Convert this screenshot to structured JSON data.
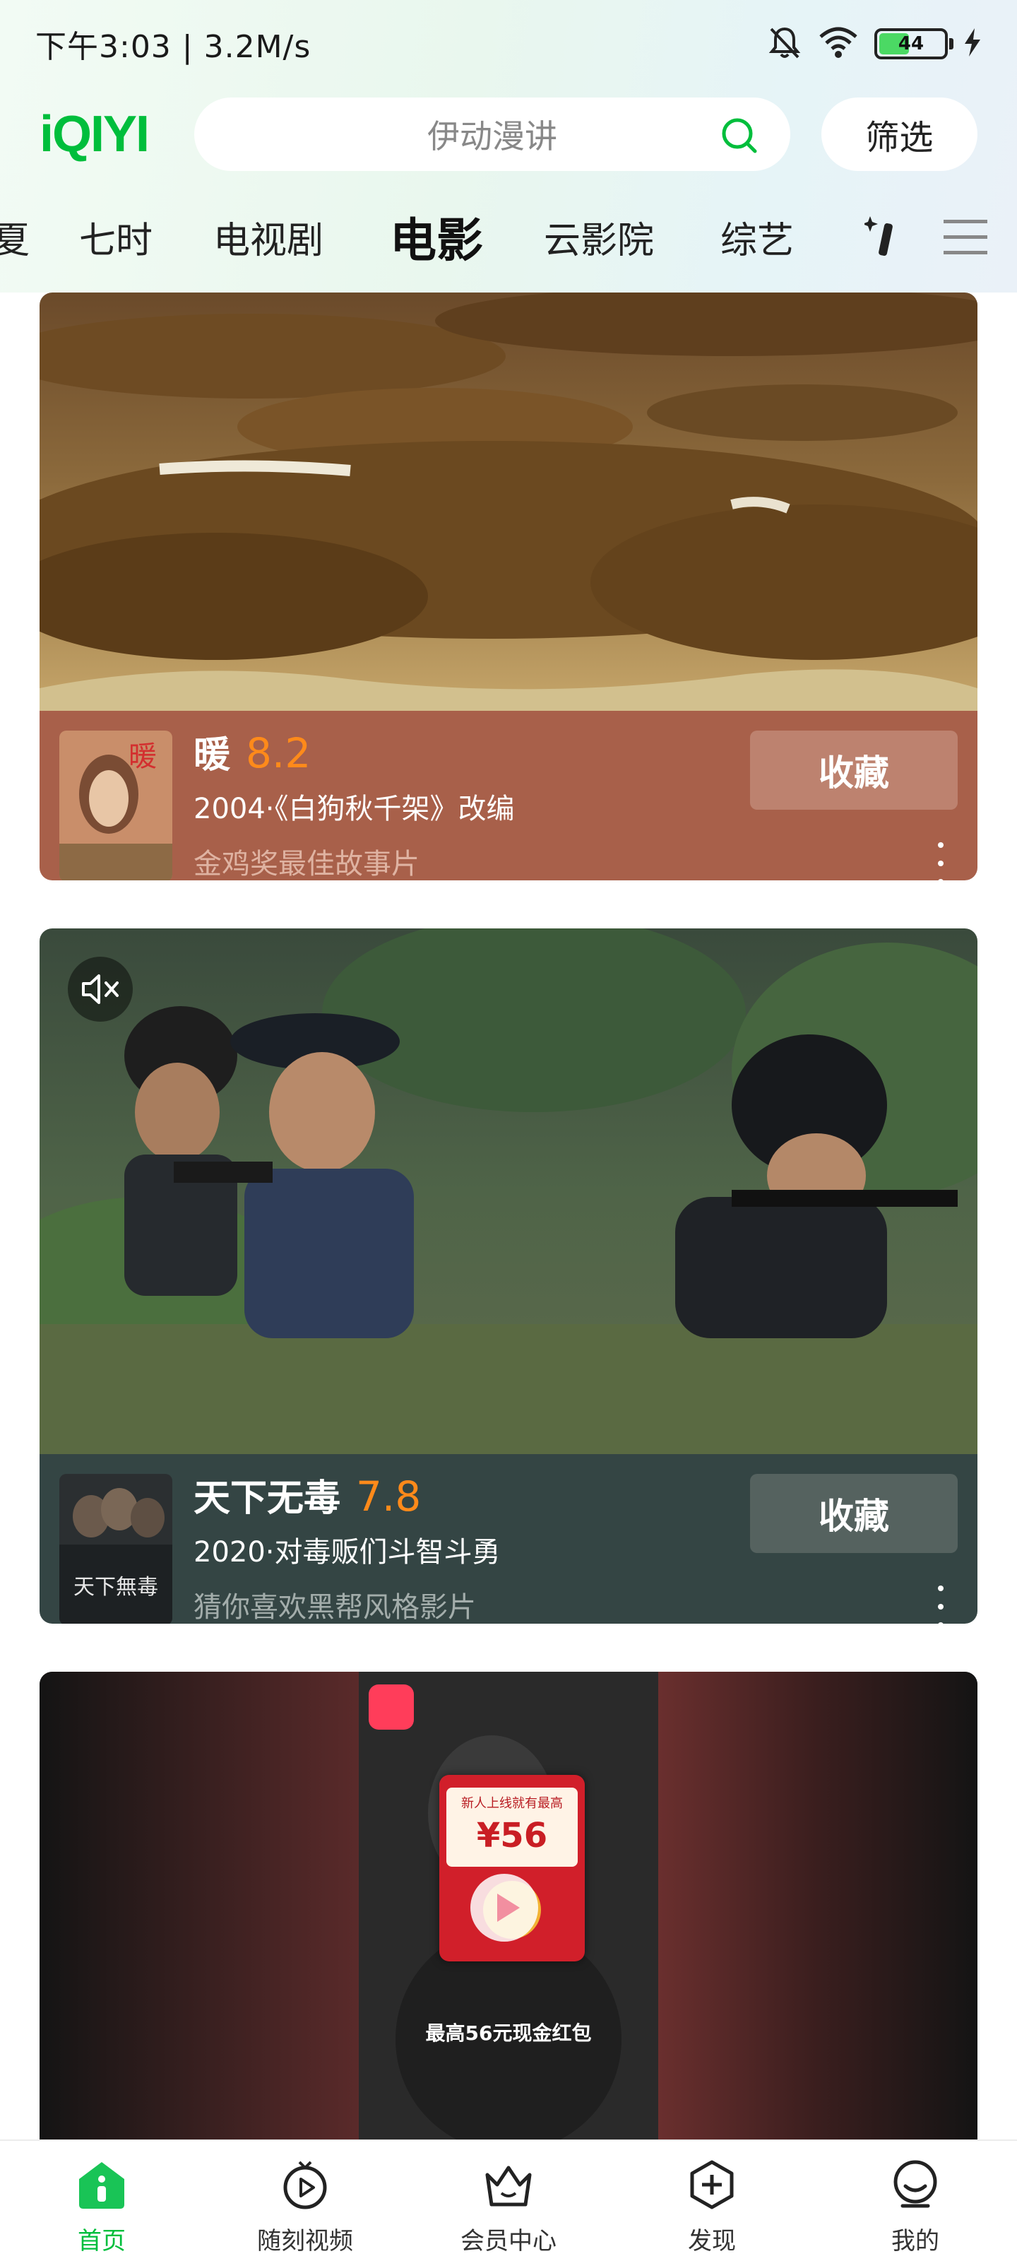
{
  "status_bar": {
    "time": "下午3:03 | 3.2M/s",
    "battery": "44",
    "icons": [
      "mute-bell-icon",
      "wifi-icon",
      "battery-icon",
      "charging-icon"
    ]
  },
  "header": {
    "logo": "iQIYI",
    "search_placeholder": "伊动漫讲",
    "filter_label": "筛选"
  },
  "tabs": [
    {
      "label": "夏",
      "active": false
    },
    {
      "label": "七时",
      "active": false
    },
    {
      "label": "电视剧",
      "active": false
    },
    {
      "label": "电影",
      "active": true
    },
    {
      "label": "云影院",
      "active": false
    },
    {
      "label": "综艺",
      "active": false
    }
  ],
  "cards": [
    {
      "title": "暖",
      "score": "8.2",
      "subtitle": "2004·《白狗秋千架》改编",
      "reason": "金鸡奖最佳故事片",
      "collect_label": "收藏",
      "theme_color": "#a8604a",
      "button_color": "#bd826f",
      "reason_color": "#dfb3a2"
    },
    {
      "title": "天下无毒",
      "score": "7.8",
      "subtitle": "2020·对毒贩们斗智斗勇",
      "reason": "猜你喜欢黑帮风格影片",
      "collect_label": "收藏",
      "theme_color": "#344544",
      "button_color": "#55625f",
      "reason_color": "#a3adab"
    }
  ],
  "promo": {
    "banner_text": "新人上线就有最高",
    "amount": "¥56",
    "caption": "最高56元现金红包"
  },
  "bottom_nav": [
    {
      "label": "首页",
      "icon": "home-icon",
      "active": true
    },
    {
      "label": "随刻视频",
      "icon": "play-circle-icon",
      "active": false
    },
    {
      "label": "会员中心",
      "icon": "crown-basket-icon",
      "active": false
    },
    {
      "label": "发现",
      "icon": "plus-hexagon-icon",
      "active": false
    },
    {
      "label": "我的",
      "icon": "profile-face-icon",
      "active": false
    }
  ]
}
